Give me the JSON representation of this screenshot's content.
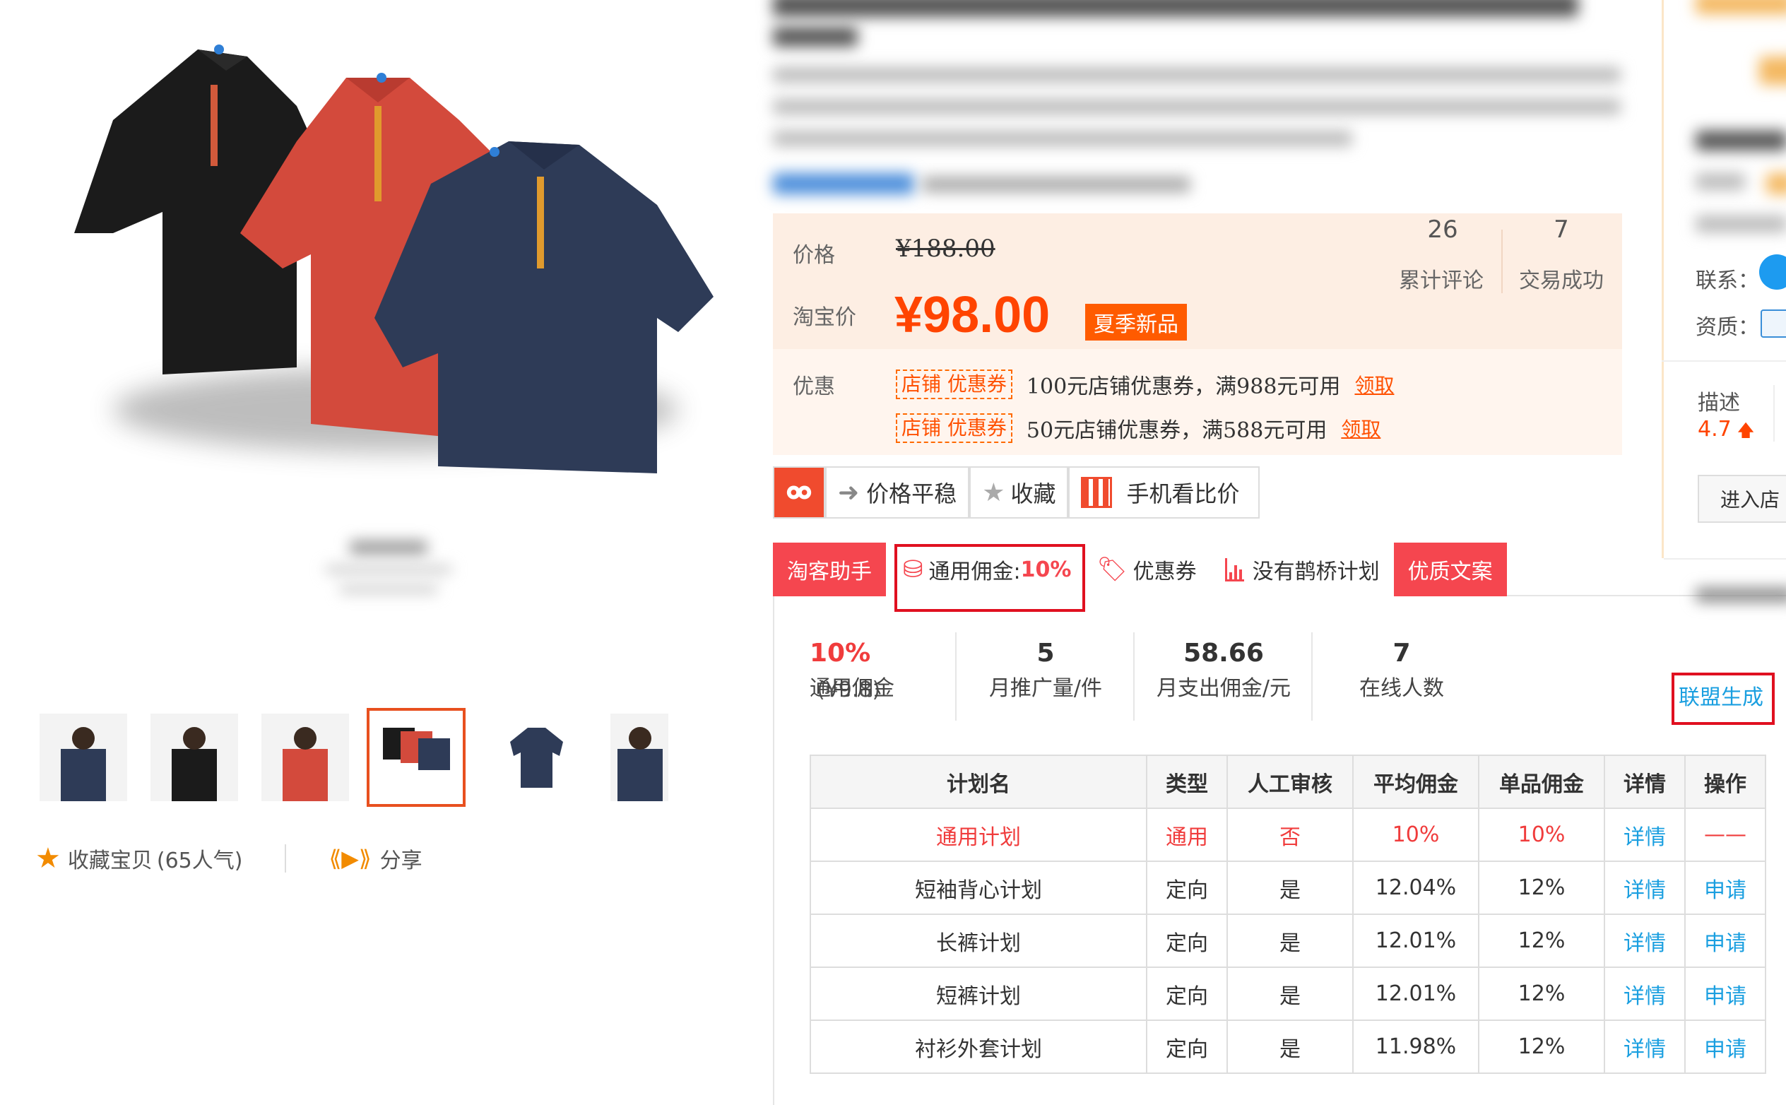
{
  "product": {
    "favorite_label": "收藏宝贝",
    "favorite_count": "(65人气)",
    "share_label": "分享",
    "thumbnails": [
      "thumb-navy-model",
      "thumb-black-model",
      "thumb-red-model",
      "thumb-three-shirts",
      "thumb-navy-flat",
      "thumb-navy-back"
    ],
    "active_thumbnail_index": 3
  },
  "price": {
    "label": "价格",
    "original": "¥188.00",
    "taobao_label": "淘宝价",
    "current": "¥98.00",
    "tag": "夏季新品",
    "reviews_label": "累计评论",
    "reviews_value": "26",
    "trades_label": "交易成功",
    "trades_value": "7"
  },
  "promo": {
    "label": "优惠",
    "coupons": [
      {
        "tag": "店铺 优惠券",
        "text": "100元店铺优惠券，满988元可用",
        "link": "领取"
      },
      {
        "tag": "店铺 优惠券",
        "text": "50元店铺优惠券，满588元可用",
        "link": "领取"
      }
    ]
  },
  "tools": {
    "price_trend": "价格平稳",
    "favorite": "收藏",
    "mobile_compare": "手机看比价"
  },
  "tabs": {
    "assistant": "淘客助手",
    "commission": "通用佣金: ",
    "commission_rate": "10%",
    "coupon": "优惠券",
    "queqiao": "没有鹊桥计划",
    "quality_copy": "优质文案"
  },
  "stats": {
    "commission_rate": "10%",
    "commission_amount": "(¥9.8)",
    "commission_label": "通用佣金",
    "monthly_promo_value": "5",
    "monthly_promo_label": "月推广量/件",
    "monthly_payout_value": "58.66",
    "monthly_payout_label": "月支出佣金/元",
    "online_value": "7",
    "online_label": "在线人数",
    "alliance_button": "联盟生成"
  },
  "plan_table": {
    "headers": [
      "计划名",
      "类型",
      "人工审核",
      "平均佣金",
      "单品佣金",
      "详情",
      "操作"
    ],
    "rows": [
      [
        "通用计划",
        "通用",
        "否",
        "10%",
        "10%",
        "详情",
        "——"
      ],
      [
        "短袖背心计划",
        "定向",
        "是",
        "12.04%",
        "12%",
        "详情",
        "申请"
      ],
      [
        "长裤计划",
        "定向",
        "是",
        "12.01%",
        "12%",
        "详情",
        "申请"
      ],
      [
        "短裤计划",
        "定向",
        "是",
        "12.01%",
        "12%",
        "详情",
        "申请"
      ],
      [
        "衬衫外套计划",
        "定向",
        "是",
        "11.98%",
        "12%",
        "详情",
        "申请"
      ]
    ]
  },
  "sidebar": {
    "contact_label": "联系：",
    "qualification_label": "资质：",
    "describe_label": "描述",
    "describe_score": "4.7",
    "enter_shop": "进入店"
  },
  "colors": {
    "accent_orange": "#ff4400",
    "tab_red": "#f5464f",
    "link_blue": "#1a9fe0",
    "highlight_red": "#e01020"
  }
}
